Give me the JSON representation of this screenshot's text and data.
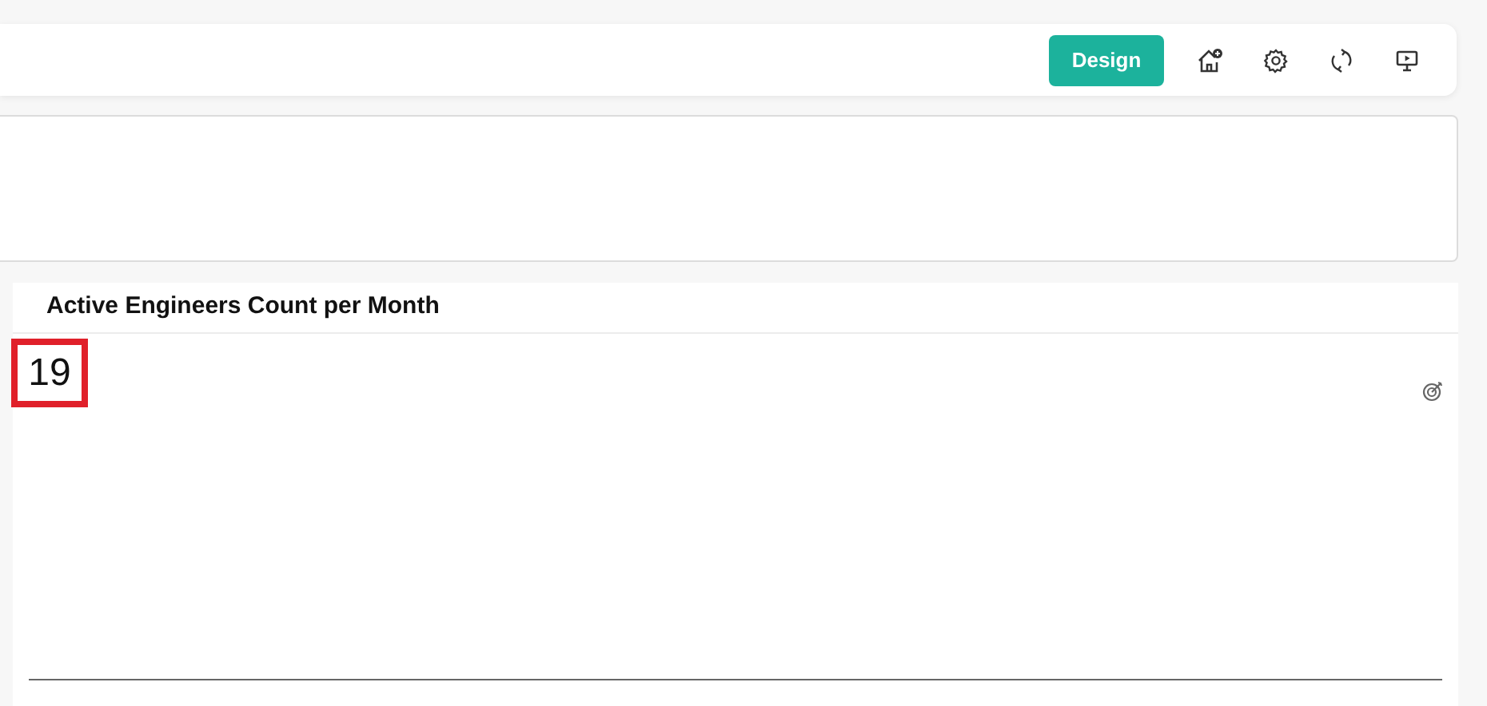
{
  "toolbar": {
    "design_button": "Design"
  },
  "widget": {
    "title": "Active Engineers Count per Month",
    "value": "19",
    "highlighted": true
  }
}
